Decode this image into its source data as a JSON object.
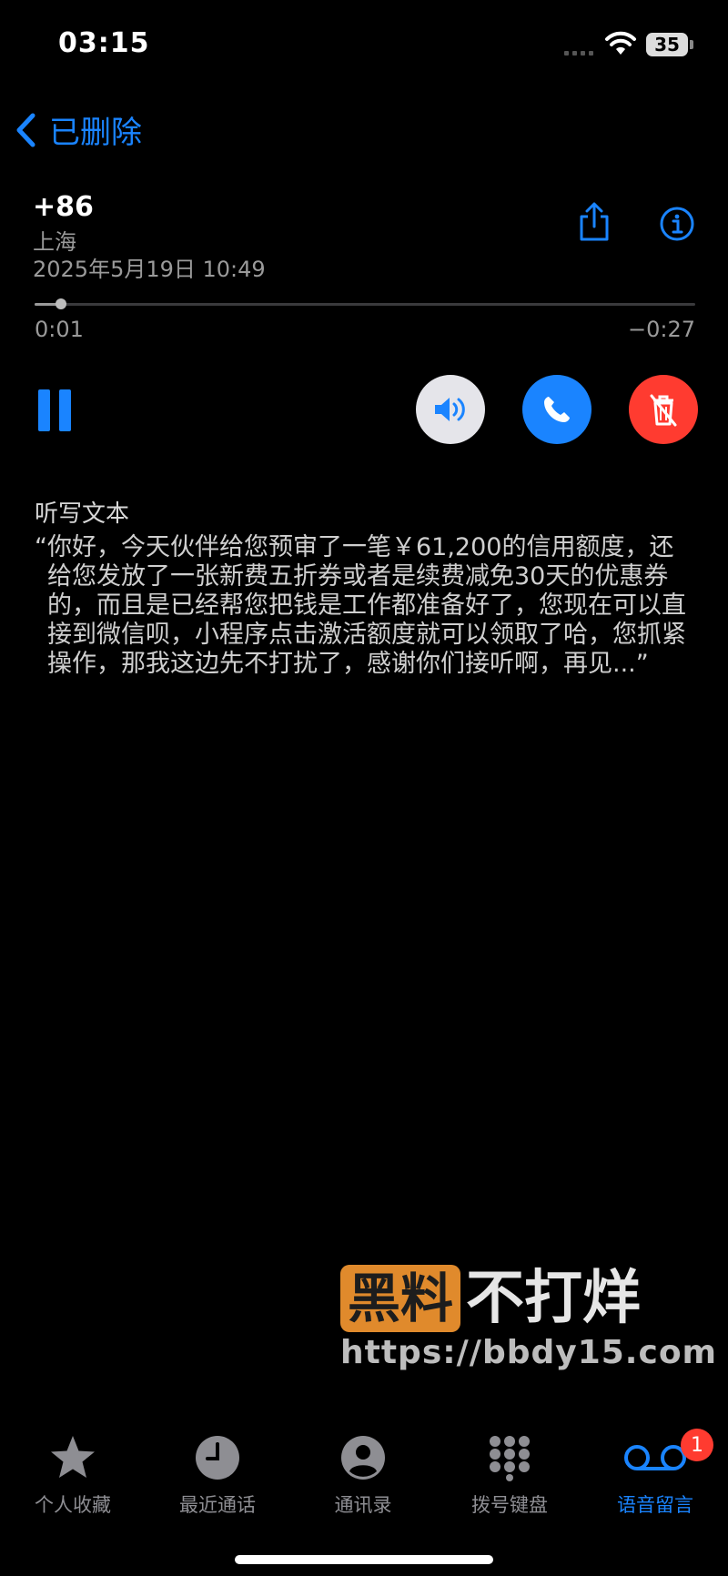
{
  "status_bar": {
    "time": "03:15",
    "battery": "35"
  },
  "nav": {
    "back_label": "已删除"
  },
  "voicemail": {
    "number": "+86",
    "location": "上海",
    "datetime": "2025年5月19日 10:49",
    "elapsed": "0:01",
    "remaining": "−0:27",
    "progress": 0.04
  },
  "transcript": {
    "title": "听写文本",
    "text": "“你好，今天伙伴给您预审了一笔￥61,200的信用额度，还给您发放了一张新费五折券或者是续费减免30天的优惠券的，而且是已经帮您把钱是工作都准备好了，您现在可以直接到微信呗，小程序点击激活额度就可以领取了哈，您抓紧操作，那我这边先不打扰了，感谢你们接听啊，再见...”"
  },
  "watermark": {
    "box": "黑料",
    "text": "不打烊",
    "url": "https://bbdy15.com"
  },
  "tabs": [
    {
      "label": "个人收藏",
      "icon": "star-icon"
    },
    {
      "label": "最近通话",
      "icon": "clock-icon"
    },
    {
      "label": "通讯录",
      "icon": "person-circle-icon"
    },
    {
      "label": "拨号键盘",
      "icon": "keypad-icon"
    },
    {
      "label": "语音留言",
      "icon": "voicemail-icon",
      "badge": "1"
    }
  ],
  "colors": {
    "accent": "#1a84ff",
    "danger": "#ff3b30",
    "secondary_text": "#9a9a9a"
  }
}
